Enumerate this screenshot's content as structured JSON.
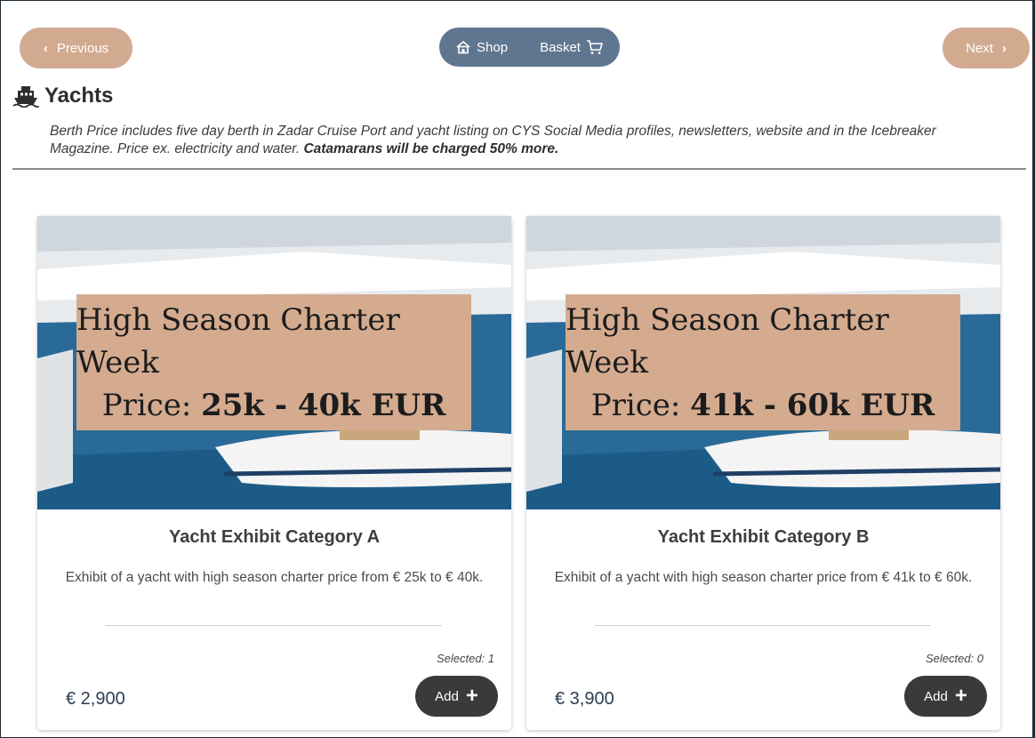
{
  "nav": {
    "previous_label": "Previous",
    "next_label": "Next",
    "shop_label": "Shop",
    "basket_label": "Basket"
  },
  "section": {
    "title": "Yachts",
    "description": "Berth Price includes five day berth in Zadar Cruise Port and yacht listing on CYS Social Media profiles, newsletters, website and in the Icebreaker Magazine. Price ex. electricity and water.",
    "description_bold": "Catamarans will be charged 50% more."
  },
  "cards": [
    {
      "overlay_line1": "High Season Charter Week",
      "overlay_price_prefix": "Price:",
      "overlay_price": "25k - 40k EUR",
      "title": "Yacht Exhibit Category A",
      "description": "Exhibit of a yacht with high season charter price from € 25k to € 40k.",
      "selected": "Selected: 1",
      "price": "€ 2,900",
      "add_label": "Add"
    },
    {
      "overlay_line1": "High Season Charter Week",
      "overlay_price_prefix": "Price:",
      "overlay_price": "41k - 60k EUR",
      "title": "Yacht Exhibit Category B",
      "description": "Exhibit of a yacht with high season charter price from € 41k to € 60k.",
      "selected": "Selected: 0",
      "price": "€ 3,900",
      "add_label": "Add"
    }
  ],
  "colors": {
    "accent_tan": "#d2aa90",
    "nav_blue": "#5f7690",
    "button_dark": "#3a3a3a"
  }
}
